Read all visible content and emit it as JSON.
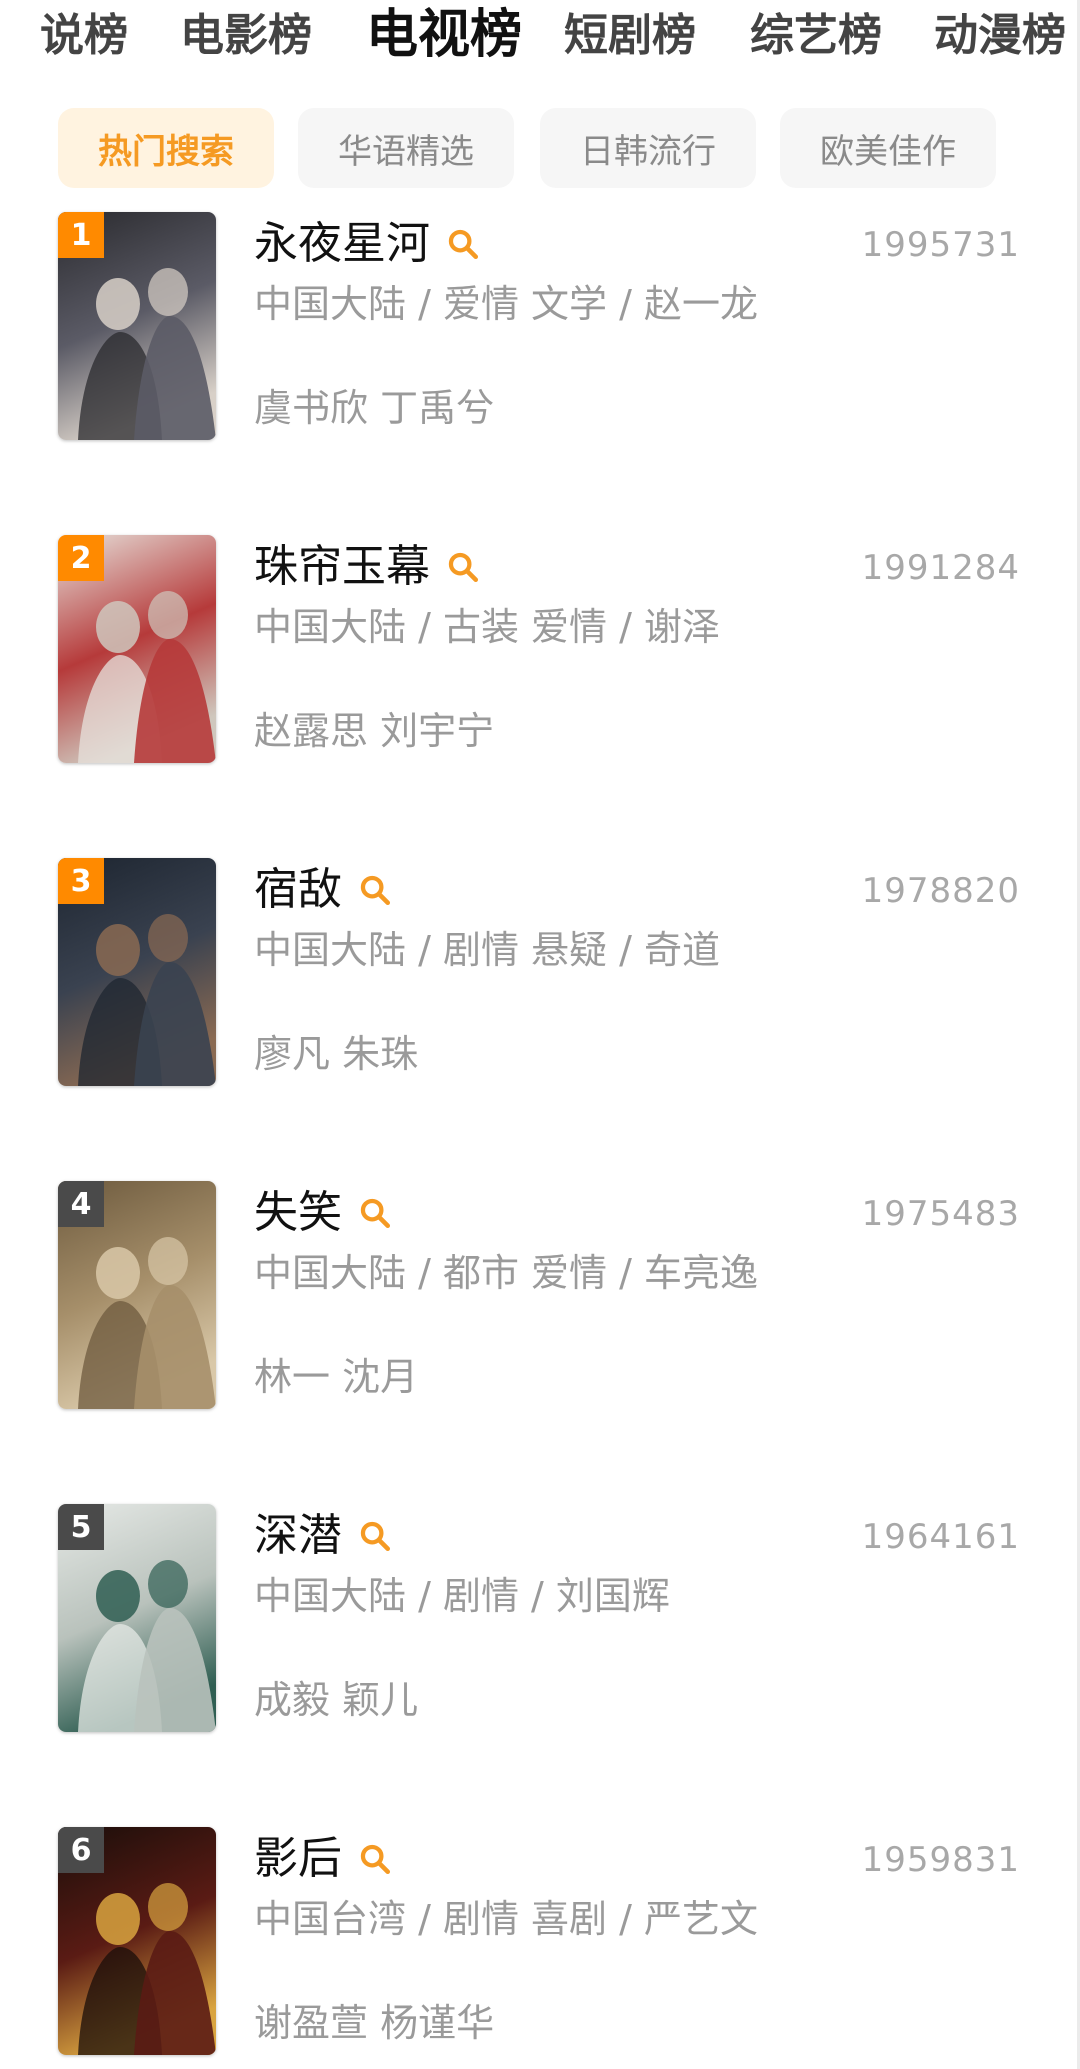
{
  "tabs": [
    "说榜",
    "电影榜",
    "电视榜",
    "短剧榜",
    "综艺榜",
    "动漫榜"
  ],
  "active_tab_index": 2,
  "chips": [
    "热门搜索",
    "华语精选",
    "日韩流行",
    "欧美佳作"
  ],
  "active_chip_index": 0,
  "colors": {
    "accent": "#f59a23",
    "rank_badge_top": "#ff8a00",
    "rank_badge_other": "#4a4a4a"
  },
  "items": [
    {
      "rank": "1",
      "title": "永夜星河",
      "score": "1995731",
      "meta": "中国大陆 / 爱情 文学 / 赵一龙",
      "cast": "虞书欣 丁禹兮",
      "poster_title": "永夜星河",
      "poster_colors": [
        "#2a2a2e",
        "#5b5b66",
        "#d8d0c8"
      ]
    },
    {
      "rank": "2",
      "title": "珠帘玉幕",
      "score": "1991284",
      "meta": "中国大陆 / 古装 爱情 / 谢泽",
      "cast": "赵露思 刘宇宁",
      "poster_title": "珠帘玉幕",
      "poster_colors": [
        "#e7e2dc",
        "#b63a3a",
        "#cfc7bd"
      ]
    },
    {
      "rank": "3",
      "title": "宿敌",
      "score": "1978820",
      "meta": "中国大陆 / 剧情 悬疑 / 奇道",
      "cast": "廖凡 朱珠",
      "poster_title": "宿敌",
      "poster_colors": [
        "#1d2530",
        "#3a4250",
        "#8a6a52"
      ]
    },
    {
      "rank": "4",
      "title": "失笑",
      "score": "1975483",
      "meta": "中国大陆 / 都市 爱情 / 车亮逸",
      "cast": "林一 沈月",
      "poster_title": "失笑",
      "poster_colors": [
        "#6d5a3e",
        "#a68f6a",
        "#d9c8a8"
      ]
    },
    {
      "rank": "5",
      "title": "深潜",
      "score": "1964161",
      "meta": "中国大陆 / 剧情 / 刘国辉",
      "cast": "成毅 颖儿",
      "poster_title": "深潜",
      "poster_colors": [
        "#e6e9e6",
        "#b9c2bc",
        "#2f5e52"
      ]
    },
    {
      "rank": "6",
      "title": "影后",
      "score": "1959831",
      "meta": "中国台湾 / 剧情 喜剧 / 严艺文",
      "cast": "谢盈萱 杨谨华",
      "poster_title": "影后",
      "poster_colors": [
        "#1a0e0a",
        "#5a1b14",
        "#d9a440"
      ]
    }
  ]
}
